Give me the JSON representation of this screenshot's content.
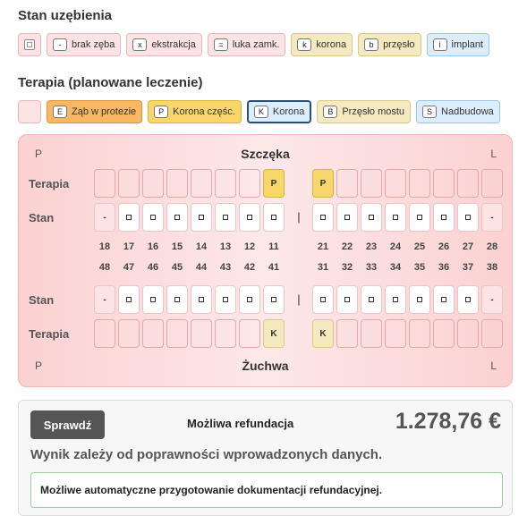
{
  "stan": {
    "title": "Stan uzębienia",
    "legend": [
      {
        "key": "",
        "label": "",
        "style": "pink",
        "blank": true
      },
      {
        "key": "-",
        "label": "brak zęba",
        "style": "pink"
      },
      {
        "key": "x",
        "label": "ekstrakcja",
        "style": "pink"
      },
      {
        "key": "=",
        "label": "luka zamk.",
        "style": "pink"
      },
      {
        "key": "k",
        "label": "korona",
        "style": "yellow"
      },
      {
        "key": "b",
        "label": "przęsło",
        "style": "yellow"
      },
      {
        "key": "i",
        "label": "implant",
        "style": "blue"
      }
    ]
  },
  "terapia": {
    "title": "Terapia (planowane leczenie)",
    "legend": [
      {
        "key": "",
        "label": "",
        "style": "pink",
        "blank": true
      },
      {
        "key": "E",
        "label": "Ząb w protezie",
        "style": "orange"
      },
      {
        "key": "P",
        "label": "Korona częśc.",
        "style": "gold"
      },
      {
        "key": "K",
        "label": "Korona",
        "style": "navy"
      },
      {
        "key": "B",
        "label": "Przęsło mostu",
        "style": "cream"
      },
      {
        "key": "S",
        "label": "Nadbudowa",
        "style": "blue"
      }
    ]
  },
  "chart": {
    "side_left": "P",
    "side_right": "L",
    "upper_jaw": "Szczęka",
    "lower_jaw": "Żuchwa",
    "row_therapy": "Terapia",
    "row_status": "Stan",
    "separator": "|",
    "upper_numbers": [
      "18",
      "17",
      "16",
      "15",
      "14",
      "13",
      "12",
      "11",
      "21",
      "22",
      "23",
      "24",
      "25",
      "26",
      "27",
      "28"
    ],
    "lower_numbers": [
      "48",
      "47",
      "46",
      "45",
      "44",
      "43",
      "42",
      "41",
      "31",
      "32",
      "33",
      "34",
      "35",
      "36",
      "37",
      "38"
    ],
    "upper_status": [
      "-",
      "o",
      "o",
      "o",
      "o",
      "o",
      "o",
      "o",
      "o",
      "o",
      "o",
      "o",
      "o",
      "o",
      "o",
      "-"
    ],
    "lower_status": [
      "-",
      "o",
      "o",
      "o",
      "o",
      "o",
      "o",
      "o",
      "o",
      "o",
      "o",
      "o",
      "o",
      "o",
      "o",
      "-"
    ],
    "upper_therapy": [
      "",
      "",
      "",
      "",
      "",
      "",
      "",
      "P",
      "P",
      "",
      "",
      "",
      "",
      "",
      "",
      ""
    ],
    "lower_therapy": [
      "",
      "",
      "",
      "",
      "",
      "",
      "",
      "K",
      "K",
      "",
      "",
      "",
      "",
      "",
      "",
      ""
    ]
  },
  "result": {
    "button": "Sprawdź",
    "refund_label": "Możliwa refundacja",
    "amount": "1.278,76 €",
    "note": "Wynik zależy od poprawności wprowadzonych danych.",
    "info": "Możliwe automatyczne przygotowanie dokumentacji refundacyjnej."
  }
}
